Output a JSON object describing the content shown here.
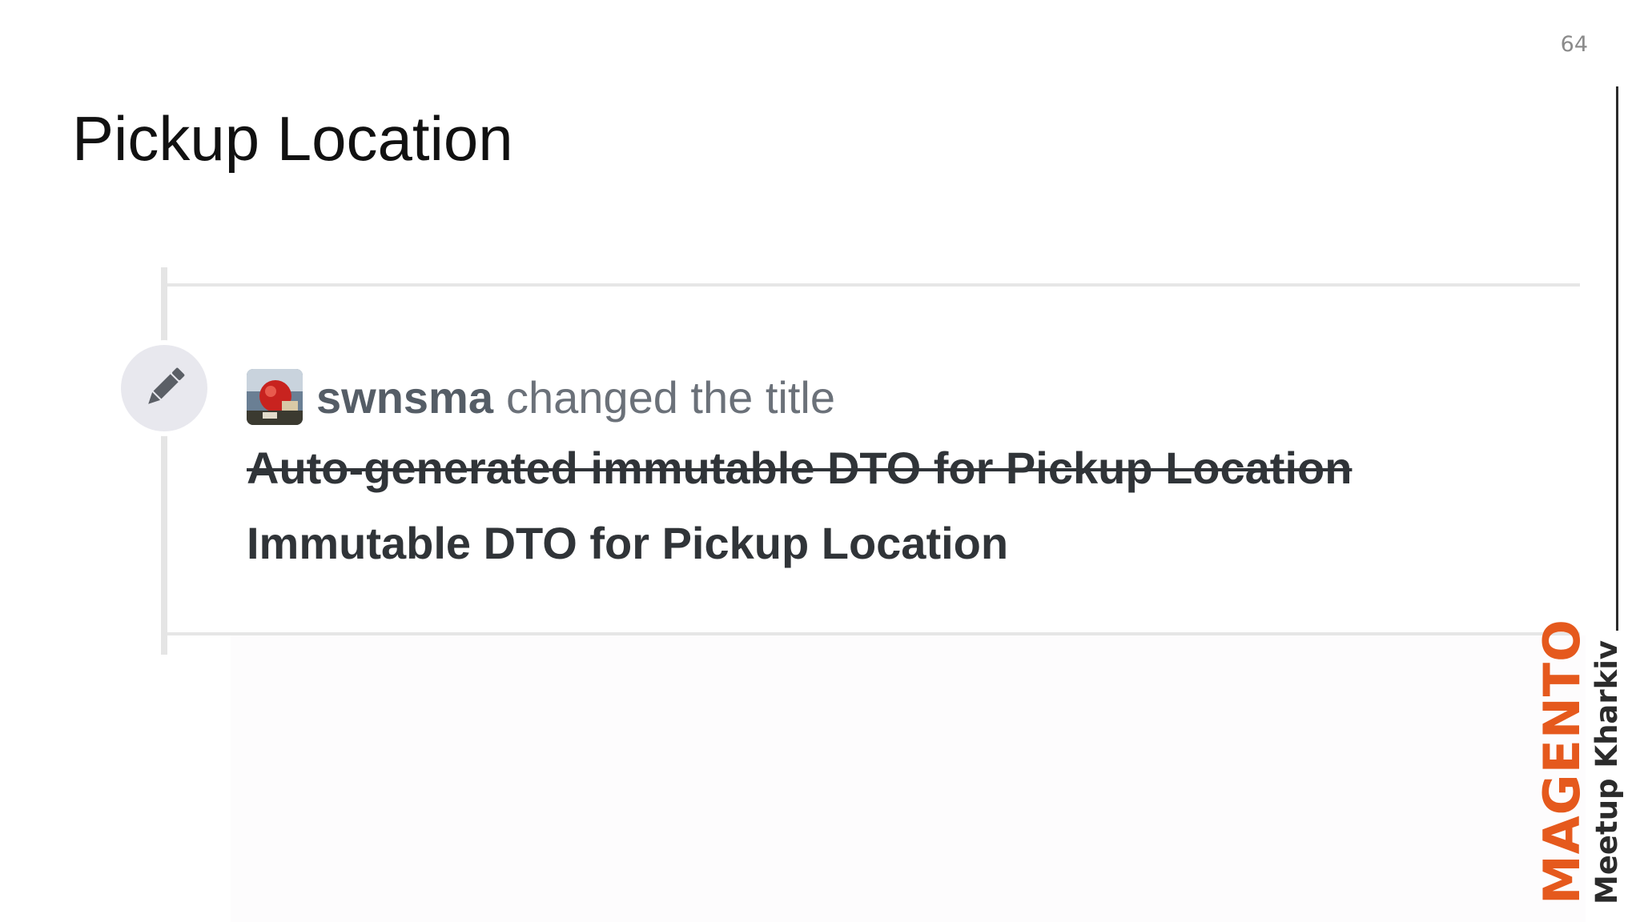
{
  "slide": {
    "page_number": "64",
    "title": "Pickup Location"
  },
  "event": {
    "icon": "pencil-icon",
    "author": "swnsma",
    "action": "changed the title",
    "old_title": "Auto-generated immutable DTO for Pickup Location",
    "new_title": "Immutable DTO for Pickup Location"
  },
  "brand": {
    "name": "MAGENTO",
    "subtitle": "Meetup Kharkiv",
    "accent_color": "#e5591d"
  }
}
